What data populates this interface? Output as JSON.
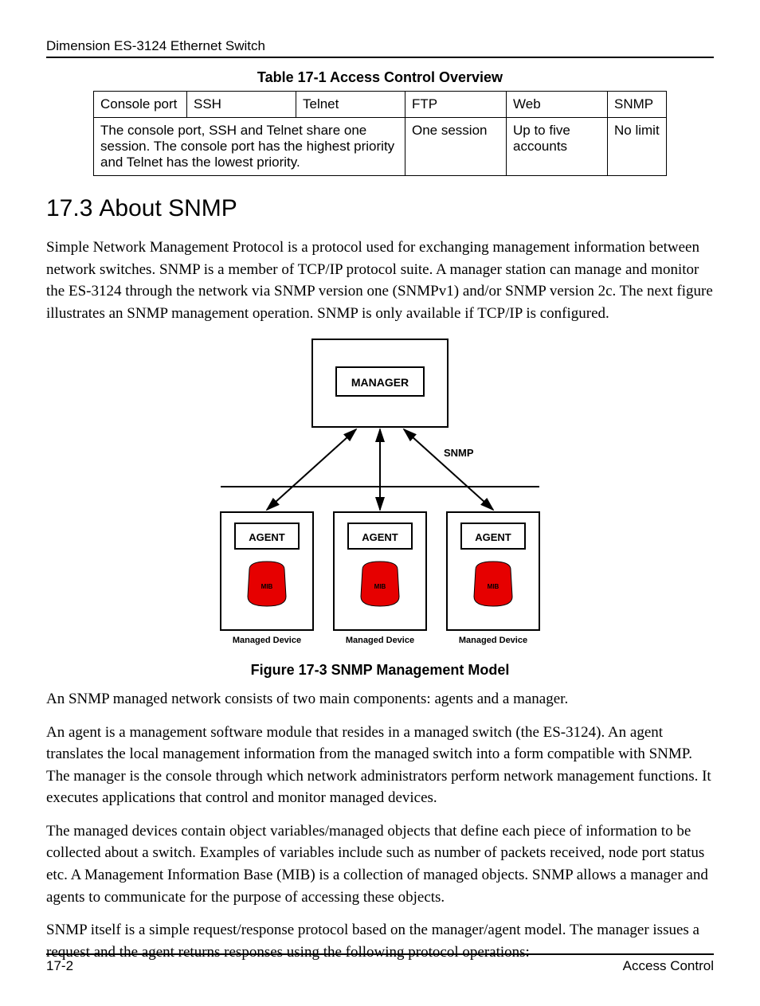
{
  "header": "Dimension ES-3124 Ethernet Switch",
  "table": {
    "caption": "Table 17-1 Access Control Overview",
    "row1": {
      "c0": "Console port",
      "c1": "SSH",
      "c2": "Telnet",
      "c3": "FTP",
      "c4": "Web",
      "c5": "SNMP"
    },
    "row2": {
      "merged": "The console port, SSH and Telnet share one session. The console port has the highest priority and Telnet has the lowest priority.",
      "ftp": "One session",
      "web": "Up to five accounts",
      "snmp": "No limit"
    }
  },
  "section": {
    "num": "17.3",
    "title": "About SNMP"
  },
  "p1": "Simple Network Management Protocol is a protocol used for exchanging management information between network switches. SNMP is a member of TCP/IP protocol suite. A manager station can manage and monitor the ES-3124 through the network via SNMP version one (SNMPv1) and/or SNMP version 2c. The next figure illustrates an SNMP management operation. SNMP is only available if TCP/IP is configured.",
  "figure": {
    "caption": "Figure 17-3 SNMP Management Model",
    "manager": "MANAGER",
    "snmp_label": "SNMP",
    "agent": "AGENT",
    "mib": "MIB",
    "managed": "Managed Device"
  },
  "p2": "An SNMP managed network consists of two main components: agents and a manager.",
  "p3": "An agent is a management software module that resides in a managed switch (the ES-3124). An agent translates the local management information from the managed switch into a form compatible with SNMP. The manager is the console through which network administrators perform network management functions. It executes applications that control and monitor managed devices.",
  "p4": "The managed devices contain object variables/managed objects that define each piece of information to be collected about a switch. Examples of variables include such as number of packets received, node port status etc. A Management Information Base (MIB) is a collection of managed objects.  SNMP allows a manager and agents to communicate for the purpose of accessing these objects.",
  "p5": "SNMP itself is a simple request/response protocol based on the manager/agent model. The manager issues a request and the agent returns responses using the following protocol operations:",
  "footer": {
    "left": "17-2",
    "right": "Access Control"
  }
}
